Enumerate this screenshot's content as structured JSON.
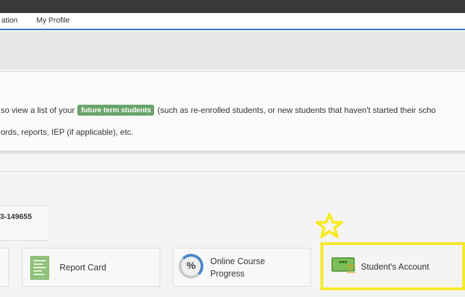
{
  "nav": {
    "items": [
      {
        "label": "ation"
      },
      {
        "label": "My Profile"
      }
    ]
  },
  "info": {
    "line1_before": "so view a list of your",
    "badge": "future term students",
    "line1_after": "(such as re-enrolled students, or new students that haven't started their scho",
    "line2": "ords, reports, IEP (if applicable), etc."
  },
  "student": {
    "id_fragment": "3-149655"
  },
  "tiles": {
    "report_card": "Report Card",
    "online_progress_line1": "Online Course",
    "online_progress_line2": "Progress",
    "students_account": "Student's Account",
    "students_account_icon_text": "***"
  },
  "icons": {
    "report_card": "report-card-icon",
    "progress": "percent-circle-icon",
    "account": "password-card-key-icon",
    "annotation": "star-icon"
  },
  "colors": {
    "topbar": "#3a3a3a",
    "nav_accent": "#2c73c4",
    "badge": "#6aa46a",
    "highlight": "#f6ea23"
  }
}
